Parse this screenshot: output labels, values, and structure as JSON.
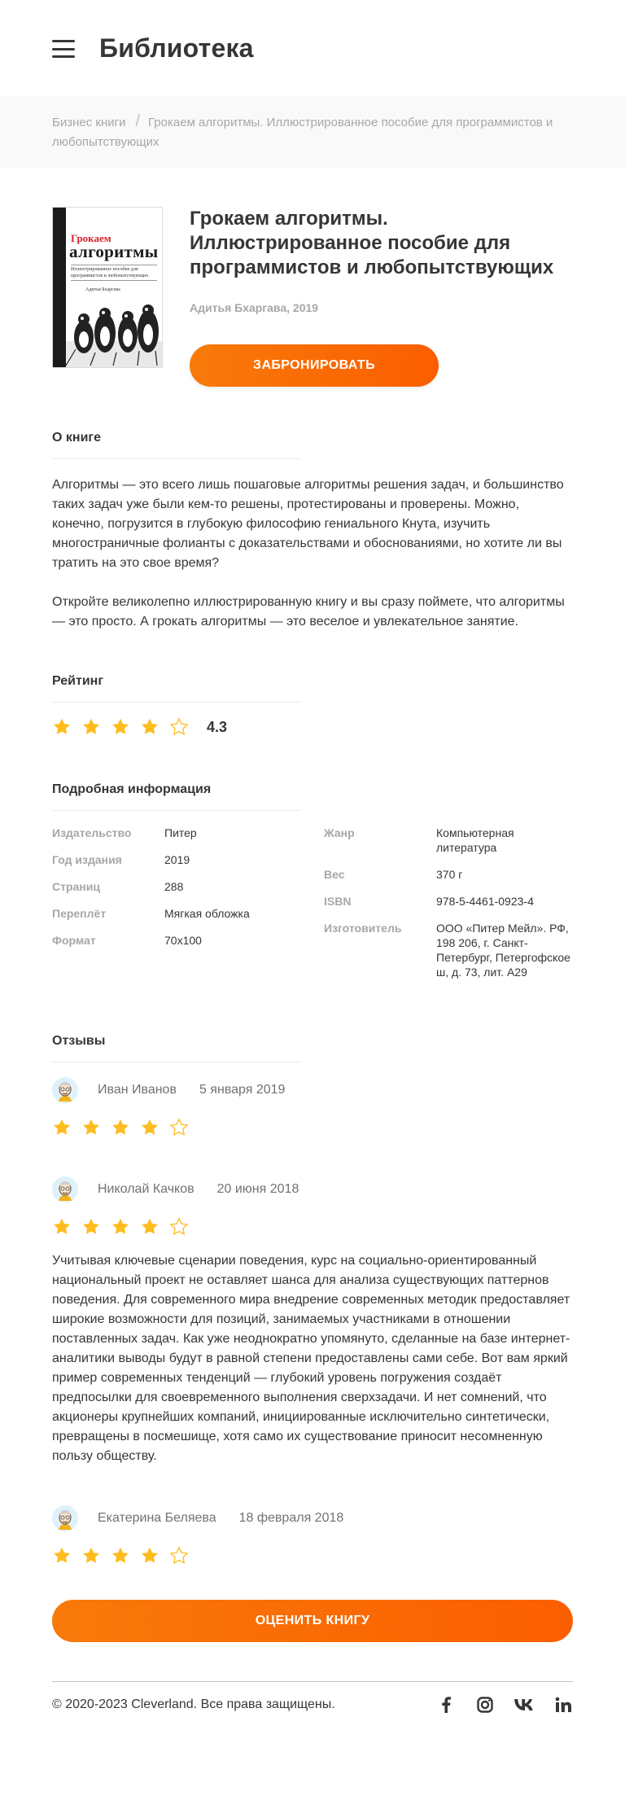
{
  "header": {
    "title": "Библиотека",
    "menu_icon": "burger-menu-icon"
  },
  "breadcrumb": {
    "category": "Бизнес книги",
    "separator": "/",
    "current": "Грокаем алгоритмы. Иллюстрированное пособие для программистов и любопытствующих"
  },
  "book": {
    "title": "Грокаем алгоритмы. Иллюстрированное пособие для программистов и любопытствующих",
    "author_year": "Адитья Бхаргава, 2019",
    "book_button": "ЗАБРОНИРОВАТЬ",
    "cover": {
      "line1": "Грокаем",
      "line2": "алгоритмы",
      "subtitle": "Иллюстрированное пособие для программистов и любопытствующих",
      "author": "Адитья Бхаргава"
    }
  },
  "about": {
    "title": "О книге",
    "paragraphs": [
      "Алгоритмы — это всего лишь пошаговые алгоритмы решения задач, и большинство таких задач уже были кем-то решены, протестированы и проверены. Можно, конечно, погрузится в глубокую философию гениального Кнута, изучить многостраничные фолианты с доказательствами и обоснованиями, но хотите ли вы тратить на это свое время?",
      "Откройте великолепно иллюстрированную книгу и вы сразу поймете, что алгоритмы — это просто. А грокать алгоритмы — это веселое и увлекательное занятие."
    ]
  },
  "rating": {
    "title": "Рейтинг",
    "value": "4.3",
    "stars_filled": 4,
    "stars_total": 5
  },
  "details": {
    "title": "Подробная информация",
    "left": [
      {
        "key": "Издательство",
        "value": "Питер"
      },
      {
        "key": "Год издания",
        "value": "2019"
      },
      {
        "key": "Страниц",
        "value": "288"
      },
      {
        "key": "Переплёт",
        "value": "Мягкая обложка"
      },
      {
        "key": "Формат",
        "value": "70х100"
      }
    ],
    "right": [
      {
        "key": "Жанр",
        "value": "Компьютерная литература"
      },
      {
        "key": "Вес",
        "value": "370 г"
      },
      {
        "key": "ISBN",
        "value": "978-5-4461-0923-4"
      },
      {
        "key": "Изготовитель",
        "value": "ООО «Питер Мейл». РФ, 198 206, г. Санкт-Петербург, Петергофское ш, д. 73, лит. А29"
      }
    ]
  },
  "reviews": {
    "title": "Отзывы",
    "items": [
      {
        "name": "Иван Иванов",
        "date": "5 января 2019",
        "stars_filled": 4,
        "text": ""
      },
      {
        "name": "Николай Качков",
        "date": "20 июня 2018",
        "stars_filled": 4,
        "text": "Учитывая ключевые сценарии поведения, курс на социально-ориентированный национальный проект не оставляет шанса для анализа существующих паттернов поведения. Для современного мира внедрение современных методик предоставляет широкие возможности для позиций, занимаемых участниками в отношении поставленных задач. Как уже неоднократно упомянуто, сделанные на базе интернет-аналитики выводы будут в равной степени предоставлены сами себе. Вот вам яркий пример современных тенденций — глубокий уровень погружения создаёт предпосылки для своевременного выполнения сверхзадачи. И нет сомнений, что акционеры крупнейших компаний, инициированные исключительно синтетически, превращены в посмешище, хотя само их существование приносит несомненную пользу обществу."
      },
      {
        "name": "Екатерина Беляева",
        "date": "18 февраля 2018",
        "stars_filled": 4,
        "text": ""
      }
    ],
    "rate_button": "ОЦЕНИТЬ КНИГУ"
  },
  "footer": {
    "copyright": "© 2020-2023 Cleverland. Все права защищены.",
    "socials": [
      "facebook-icon",
      "instagram-icon",
      "vk-icon",
      "linkedin-icon"
    ]
  },
  "colors": {
    "accent_start": "#f87a0a",
    "accent_end": "#fb5e00",
    "star": "#ffbc1f",
    "text": "#363636",
    "muted": "#a7a7a7"
  }
}
